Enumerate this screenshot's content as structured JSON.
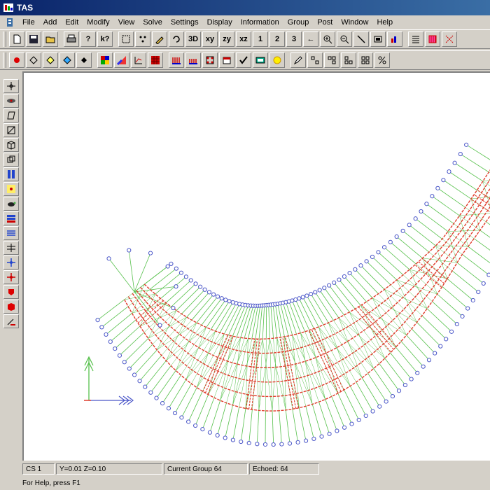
{
  "window": {
    "title": "TAS"
  },
  "menu": {
    "items": [
      "File",
      "Add",
      "Edit",
      "Modify",
      "View",
      "Solve",
      "Settings",
      "Display",
      "Information",
      "Group",
      "Post",
      "Window",
      "Help"
    ]
  },
  "toolbar1": {
    "buttons": [
      {
        "name": "new-icon",
        "label": ""
      },
      {
        "name": "save-icon",
        "label": ""
      },
      {
        "name": "open-icon",
        "label": ""
      },
      {
        "name": "print-icon",
        "label": ""
      },
      {
        "name": "help-icon",
        "label": "?"
      },
      {
        "name": "context-help-icon",
        "label": "k?"
      },
      {
        "name": "select-box-icon",
        "label": ""
      },
      {
        "name": "select-nodes-icon",
        "label": ""
      },
      {
        "name": "pick-icon",
        "label": ""
      },
      {
        "name": "rotate-icon",
        "label": ""
      },
      {
        "name": "view-3d-button",
        "label": "3D"
      },
      {
        "name": "view-xy-button",
        "label": "xy"
      },
      {
        "name": "view-zy-button",
        "label": "zy"
      },
      {
        "name": "view-xz-button",
        "label": "xz"
      },
      {
        "name": "view-1-button",
        "label": "1"
      },
      {
        "name": "view-2-button",
        "label": "2"
      },
      {
        "name": "view-3-button",
        "label": "3"
      },
      {
        "name": "arrow-left-icon",
        "label": "←"
      },
      {
        "name": "zoom-in-icon",
        "label": ""
      },
      {
        "name": "zoom-out-icon",
        "label": ""
      },
      {
        "name": "measure-icon",
        "label": ""
      },
      {
        "name": "fit-view-icon",
        "label": ""
      },
      {
        "name": "chart-icon",
        "label": ""
      },
      {
        "name": "list-icon",
        "label": ""
      },
      {
        "name": "grid-icon",
        "label": ""
      },
      {
        "name": "mesh-icon",
        "label": ""
      }
    ]
  },
  "toolbar2": {
    "buttons": [
      {
        "name": "node-red-icon"
      },
      {
        "name": "shape-outline-icon"
      },
      {
        "name": "shape-yellow-icon"
      },
      {
        "name": "shape-blue-icon"
      },
      {
        "name": "diamond-black-icon"
      },
      {
        "name": "color-map-icon"
      },
      {
        "name": "gradient-icon"
      },
      {
        "name": "axis-plot-icon"
      },
      {
        "name": "red-grid-icon"
      },
      {
        "name": "bar-icon-1"
      },
      {
        "name": "bar-icon-2"
      },
      {
        "name": "dots-icon"
      },
      {
        "name": "calendar-icon"
      },
      {
        "name": "check-icon"
      },
      {
        "name": "display-icon"
      },
      {
        "name": "sun-icon"
      },
      {
        "name": "pencil-icon"
      },
      {
        "name": "small-squares-icon-1"
      },
      {
        "name": "small-squares-icon-2"
      },
      {
        "name": "small-squares-icon-3"
      },
      {
        "name": "small-squares-icon-4"
      },
      {
        "name": "percent-icon"
      }
    ]
  },
  "side_toolbar": {
    "buttons": [
      "crosshair-icon",
      "eye-icon",
      "parallelogram-icon",
      "square-outline-icon",
      "cube-icon",
      "cube-stack-icon",
      "blue-bars-icon",
      "yellow-node-icon",
      "turtle-icon",
      "blue-stack-icon",
      "lines-icon",
      "split-icon",
      "blue-cross-icon",
      "red-cross-icon",
      "red-shape-icon",
      "red-cube-icon",
      "line-node-icon"
    ]
  },
  "status": {
    "cs": "CS 1",
    "coords": "Y=0.01 Z=0.10",
    "group": "Current Group 64",
    "echoed": "Echoed: 64",
    "help": "For Help, press F1"
  },
  "colors": {
    "titlebar_start": "#0a246a",
    "titlebar_end": "#3a6ea5",
    "mesh_green": "#55c04a",
    "mesh_red": "#e03c2c",
    "node_blue": "#4a56c8",
    "axis_green": "#55c04a",
    "axis_blue": "#4a56c8"
  }
}
